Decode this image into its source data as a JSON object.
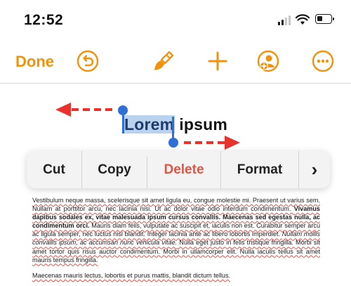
{
  "status": {
    "time": "12:52"
  },
  "toolbar": {
    "done_label": "Done",
    "icons": [
      "undo-icon",
      "paintbrush-icon",
      "plus-icon",
      "add-person-icon",
      "more-icon"
    ],
    "accent_color": "#f0930a"
  },
  "document": {
    "heading_selected": "Lorem",
    "heading_rest": "ipsum",
    "paragraph1": [
      {
        "t": "Vestibulum neque massa, scelerisque",
        "u": true
      },
      {
        "t": " sit amet ligula eu, congue molestie mi. Praesent ut varius sem. Nullam at porttitor arcu, nec lacinia nisi. Ut ac dolor vitae odio interdum condimentum. ",
        "u": true
      },
      {
        "t": "Vivamus dapibus sodales ex, vitae malesuada ipsum cursus convallis. Maecenas sed egestas nulla, ac condimentum orci.",
        "u": true,
        "b": true
      },
      {
        "t": " Mauris diam felis, vulputate ac suscipit et, iaculis non est. Curabitur semper arcu ac ligula semper, nec luctus nisl blandit. Integer lacinia ante ac libero lobortis imperdiet. ",
        "u": true
      },
      {
        "t": "Nullam mollis convallis ipsum, ac accumsan nunc vehicula vitae.",
        "u": true,
        "i": true
      },
      {
        "t": " Nulla eget justo in felis tristique fringilla. Morbi sit amet tortor quis risus auctor condimentum. Morbi in ullamcorper elit. Nulla iaculis tellus sit amet mauris tempus fringilla.",
        "u": true
      }
    ],
    "paragraph2": "Maecenas mauris lectus, lobortis et purus mattis, blandit dictum tellus."
  },
  "context_menu": {
    "items": [
      {
        "label": "Cut",
        "name": "cut"
      },
      {
        "label": "Copy",
        "name": "copy"
      },
      {
        "label": "Delete",
        "name": "delete"
      },
      {
        "label": "Format",
        "name": "format"
      },
      {
        "label": "›",
        "name": "more"
      }
    ],
    "delete_color": "#e5533f"
  },
  "annotations": {
    "arrow_color": "#e8322b"
  },
  "selection_color": "#b9d2ee",
  "handle_color": "#2f6fd6"
}
